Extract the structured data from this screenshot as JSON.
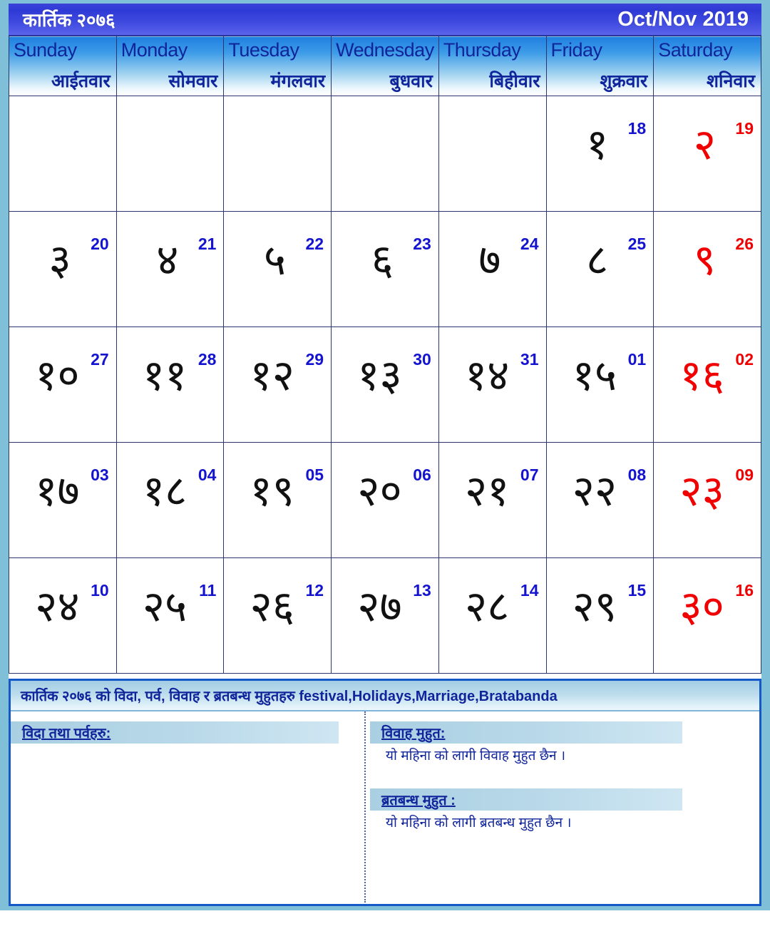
{
  "header": {
    "month_np": "कार्तिक २०७६",
    "month_en": "Oct/Nov 2019"
  },
  "weekdays": [
    {
      "en": "Sunday",
      "np": "आईतवार"
    },
    {
      "en": "Monday",
      "np": "सोमवार"
    },
    {
      "en": "Tuesday",
      "np": "मंगलवार"
    },
    {
      "en": "Wednesday",
      "np": "बुधवार"
    },
    {
      "en": "Thursday",
      "np": "बिहीवार"
    },
    {
      "en": "Friday",
      "np": "शुक्रवार"
    },
    {
      "en": "Saturday",
      "np": "शनिवार"
    }
  ],
  "weeks": [
    [
      {
        "np": "",
        "en": ""
      },
      {
        "np": "",
        "en": ""
      },
      {
        "np": "",
        "en": ""
      },
      {
        "np": "",
        "en": ""
      },
      {
        "np": "",
        "en": ""
      },
      {
        "np": "१",
        "en": "18"
      },
      {
        "np": "२",
        "en": "19"
      }
    ],
    [
      {
        "np": "३",
        "en": "20"
      },
      {
        "np": "४",
        "en": "21"
      },
      {
        "np": "५",
        "en": "22"
      },
      {
        "np": "६",
        "en": "23"
      },
      {
        "np": "७",
        "en": "24"
      },
      {
        "np": "८",
        "en": "25"
      },
      {
        "np": "९",
        "en": "26"
      }
    ],
    [
      {
        "np": "१०",
        "en": "27"
      },
      {
        "np": "११",
        "en": "28"
      },
      {
        "np": "१२",
        "en": "29"
      },
      {
        "np": "१३",
        "en": "30"
      },
      {
        "np": "१४",
        "en": "31"
      },
      {
        "np": "१५",
        "en": "01"
      },
      {
        "np": "१६",
        "en": "02"
      }
    ],
    [
      {
        "np": "१७",
        "en": "03"
      },
      {
        "np": "१८",
        "en": "04"
      },
      {
        "np": "१९",
        "en": "05"
      },
      {
        "np": "२०",
        "en": "06"
      },
      {
        "np": "२१",
        "en": "07"
      },
      {
        "np": "२२",
        "en": "08"
      },
      {
        "np": "२३",
        "en": "09"
      }
    ],
    [
      {
        "np": "२४",
        "en": "10"
      },
      {
        "np": "२५",
        "en": "11"
      },
      {
        "np": "२६",
        "en": "12"
      },
      {
        "np": "२७",
        "en": "13"
      },
      {
        "np": "२८",
        "en": "14"
      },
      {
        "np": "२९",
        "en": "15"
      },
      {
        "np": "३०",
        "en": "16"
      }
    ]
  ],
  "footer": {
    "title": "कार्तिक २०७६ को विदा, पर्व, विवाह र ब्रतबन्ध मुहुतहरु festival,Holidays,Marriage,Bratabanda",
    "holidays": {
      "heading": "विदा तथा पर्वहरु:",
      "body": ""
    },
    "marriage": {
      "heading": "विवाह मुहुत:",
      "body": "यो महिना को लागी विवाह मुहुत छैन ।"
    },
    "bratabandha": {
      "heading": "ब्रतबन्ध मुहुत :",
      "body": "यो महिना को लागी ब्रतबन्ध मुहुत छैन ।"
    }
  },
  "colors": {
    "title_bar": "#3a42d8",
    "weekday_text": "#10249b",
    "weekday_gradient_top": "#1f7fe0",
    "weekday_number": "#1414d0",
    "saturday": "#f00000",
    "frame": "#7fbfd7",
    "footer_border": "#1558c8",
    "section_header": "#a9cfe2"
  }
}
